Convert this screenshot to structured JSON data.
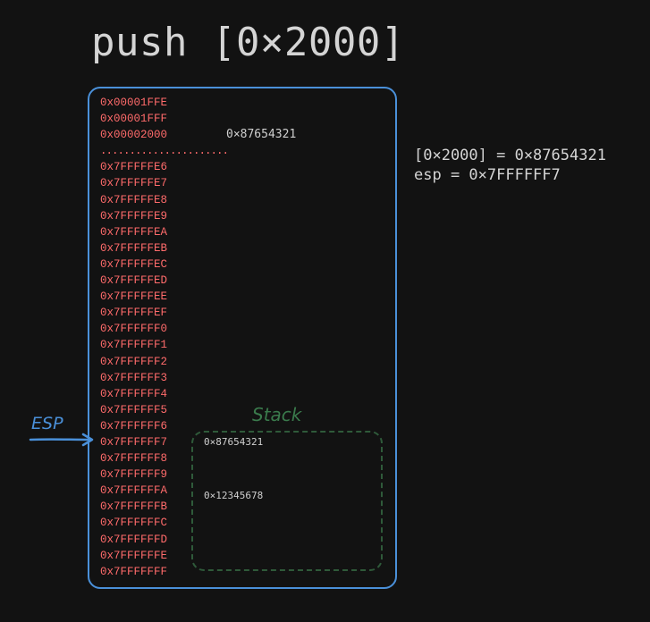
{
  "title": "push [0×2000]",
  "addresses": [
    "0x00001FFE",
    "0x00001FFF",
    "0x00002000",
    "......................",
    "0x7FFFFFE6",
    "0x7FFFFFE7",
    "0x7FFFFFE8",
    "0x7FFFFFE9",
    "0x7FFFFFEA",
    "0x7FFFFFEB",
    "0x7FFFFFEC",
    "0x7FFFFFED",
    "0x7FFFFFEE",
    "0x7FFFFFEF",
    "0x7FFFFFF0",
    "0x7FFFFFF1",
    "0x7FFFFFF2",
    "0x7FFFFFF3",
    "0x7FFFFFF4",
    "0x7FFFFFF5",
    "0x7FFFFFF6",
    "0x7FFFFFF7",
    "0x7FFFFFF8",
    "0x7FFFFFF9",
    "0x7FFFFFFA",
    "0x7FFFFFFB",
    "0x7FFFFFFC",
    "0x7FFFFFFD",
    "0x7FFFFFFE",
    "0x7FFFFFFF"
  ],
  "memory_value": "0×87654321",
  "stack": {
    "label": "Stack",
    "values": [
      "0×87654321",
      "0×12345678"
    ]
  },
  "esp_label": "ESP",
  "notes": [
    "[0×2000] = 0×87654321",
    "esp = 0×7FFFFFF7"
  ],
  "colors": {
    "address": "#ff6b6b",
    "memory_border": "#4a90d9",
    "stack_border": "#2f5a3a",
    "stack_label": "#3a7a4c",
    "esp": "#4a90d9"
  }
}
